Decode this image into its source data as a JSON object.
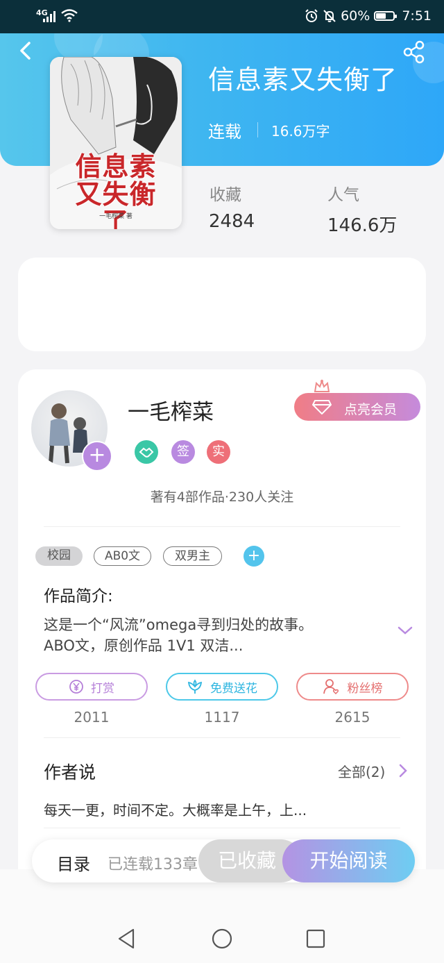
{
  "status_bar": {
    "network": "4G",
    "battery": "60%",
    "battery_fraction": 0.6,
    "time": "7:51"
  },
  "book": {
    "title": "信息素又失衡了",
    "status": "连载",
    "word_count": "16.6万字",
    "cover_title_line1": "信息素",
    "cover_title_line2": "又失衡了",
    "cover_author": "一毛榨菜 著"
  },
  "stats": {
    "favorites_label": "收藏",
    "favorites_value": "2484",
    "popularity_label": "人气",
    "popularity_value": "146.6万"
  },
  "author": {
    "name": "一毛榨菜",
    "vip_button": "点亮会员",
    "badges": [
      "签",
      "实"
    ],
    "works_info": "著有4部作品·230人关注",
    "follow_symbol": "+"
  },
  "tags": [
    "校园",
    "AB0文",
    "双男主"
  ],
  "intro": {
    "heading": "作品简介:",
    "line1": "这是一个“风流”omega寻到归处的故事。",
    "line2": "ABO文，原创作品  1V1  双洁..."
  },
  "actions": [
    {
      "label": "打赏",
      "count": "2011",
      "color": "#c99be2",
      "icon": "yen-coin-icon"
    },
    {
      "label": "免费送花",
      "count": "1117",
      "color": "#4cc8e8",
      "icon": "flower-icon"
    },
    {
      "label": "粉丝榜",
      "count": "2615",
      "color": "#ee8a8a",
      "icon": "fans-user-icon"
    }
  ],
  "author_says": {
    "heading": "作者说",
    "view_all": "全部(2)",
    "note": "每天一更，时间不定。大概率是上午，上..."
  },
  "bottom_bar": {
    "toc": "目录",
    "chapters": "已连载133章",
    "collected": "已收藏",
    "read": "开始阅读"
  },
  "colors": {
    "header_gradient_start": "#56c6ec",
    "header_gradient_end": "#2ea7f8",
    "accent_purple": "#b889e0",
    "vip_gradient_start": "#f07d86",
    "vip_gradient_end": "#c58bdc"
  }
}
